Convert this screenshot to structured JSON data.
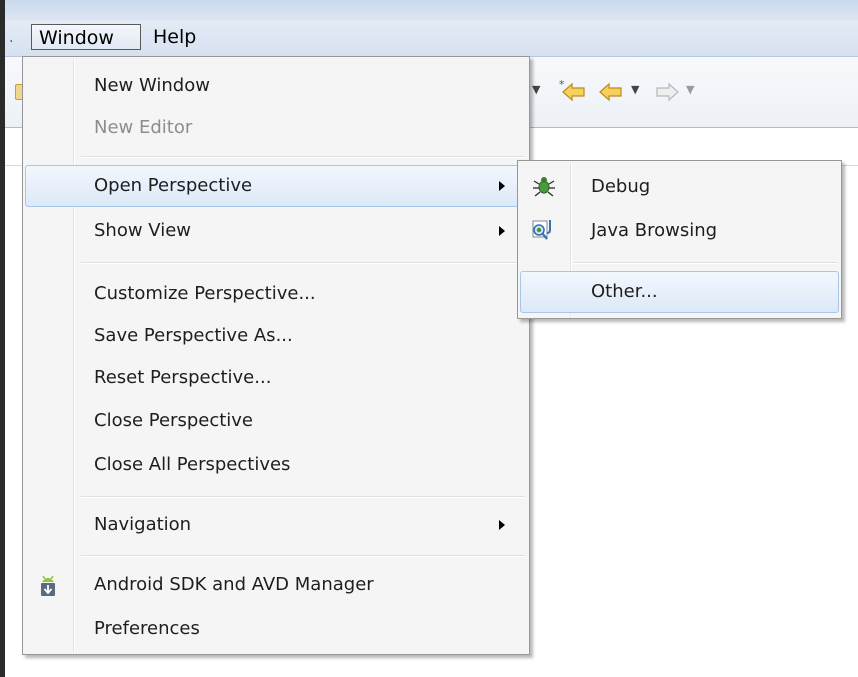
{
  "menubar": {
    "window_label": "Window",
    "help_label": "Help"
  },
  "window_menu": {
    "items": [
      {
        "label": "New Window"
      },
      {
        "label": "New Editor",
        "state": "disabled"
      },
      {
        "label": "Open Perspective",
        "state": "highlighted",
        "submenu": true
      },
      {
        "label": "Show View",
        "submenu": true
      },
      {
        "label": "Customize Perspective..."
      },
      {
        "label": "Save Perspective As..."
      },
      {
        "label": "Reset Perspective..."
      },
      {
        "label": "Close Perspective"
      },
      {
        "label": "Close All Perspectives"
      },
      {
        "label": "Navigation",
        "submenu": true
      },
      {
        "label": "Android SDK and AVD Manager",
        "icon": "android-sdk-icon"
      },
      {
        "label": "Preferences"
      }
    ]
  },
  "open_perspective_submenu": {
    "items": [
      {
        "label": "Debug",
        "icon": "debug-bug-icon"
      },
      {
        "label": "Java Browsing",
        "icon": "java-browsing-icon"
      },
      {
        "label": "Other...",
        "state": "highlighted"
      }
    ]
  },
  "toolbar": {
    "icons": [
      "last-edit-location-icon",
      "back-arrow-icon",
      "forward-arrow-icon"
    ]
  },
  "colors": {
    "menu_background": "#f5f5f5",
    "highlight_border": "#a8c6ea",
    "menubar_background": "#dce6f3",
    "nav_arrow_yellow": "#f2c94c"
  }
}
